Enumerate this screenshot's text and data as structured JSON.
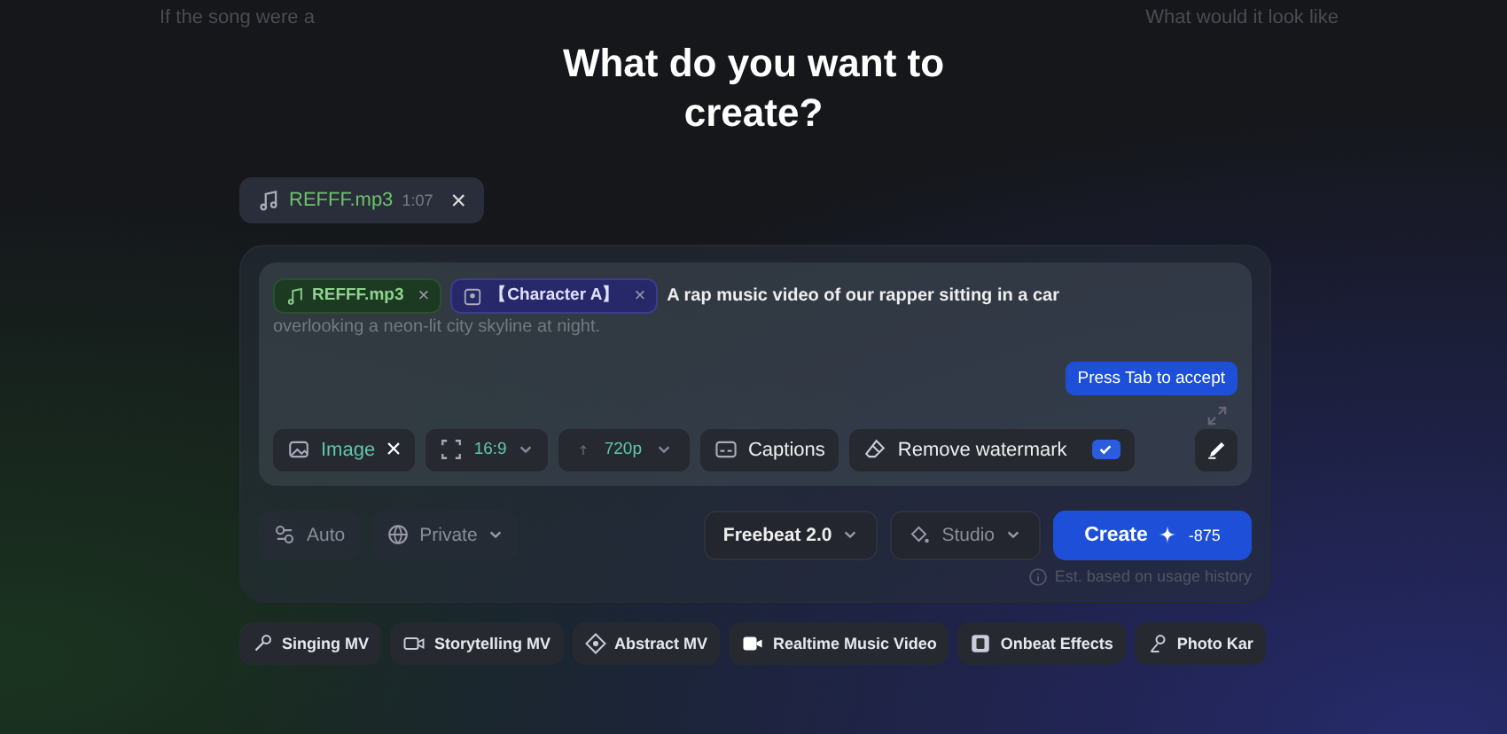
{
  "background_hints": [
    "If the song were a",
    "What would it look like"
  ],
  "title": "What do you want to create?",
  "attachment": {
    "name": "REFFF.mp3",
    "duration": "1:07",
    "close": "×"
  },
  "prompt": {
    "tags": [
      {
        "kind": "audio",
        "label": "REFFF.mp3",
        "close": "×"
      },
      {
        "kind": "character",
        "label": "【Character A】",
        "close": "×"
      }
    ],
    "text": "A rap music video of our rapper sitting in a car",
    "suggestion": "overlooking a neon-lit city skyline at night.",
    "hint": "Press Tab to accept"
  },
  "options": [
    {
      "kind": "image",
      "label": "Image",
      "close": "×"
    },
    {
      "kind": "ratio",
      "label": "16:9"
    },
    {
      "kind": "resolution",
      "label": "720p"
    },
    {
      "kind": "captions",
      "label": "Captions"
    },
    {
      "kind": "watermark",
      "label": "Remove watermark",
      "checked": true
    }
  ],
  "footer": {
    "left": [
      {
        "kind": "auto",
        "label": "Auto"
      },
      {
        "kind": "privacy",
        "label": "Private"
      }
    ],
    "right": [
      {
        "kind": "model",
        "label": "Freebeat 2.0"
      },
      {
        "kind": "style",
        "label": "Studio"
      }
    ],
    "create": {
      "label": "Create",
      "cost": "-875"
    },
    "note": "Est. based on usage history"
  },
  "templates": [
    {
      "kind": "singing",
      "label": "Singing MV"
    },
    {
      "kind": "storytelling",
      "label": "Storytelling MV"
    },
    {
      "kind": "abstract",
      "label": "Abstract MV"
    },
    {
      "kind": "realtime",
      "label": "Realtime Music Video"
    },
    {
      "kind": "onbeat",
      "label": "Onbeat Effects"
    },
    {
      "kind": "photo",
      "label": "Photo Kar"
    }
  ]
}
